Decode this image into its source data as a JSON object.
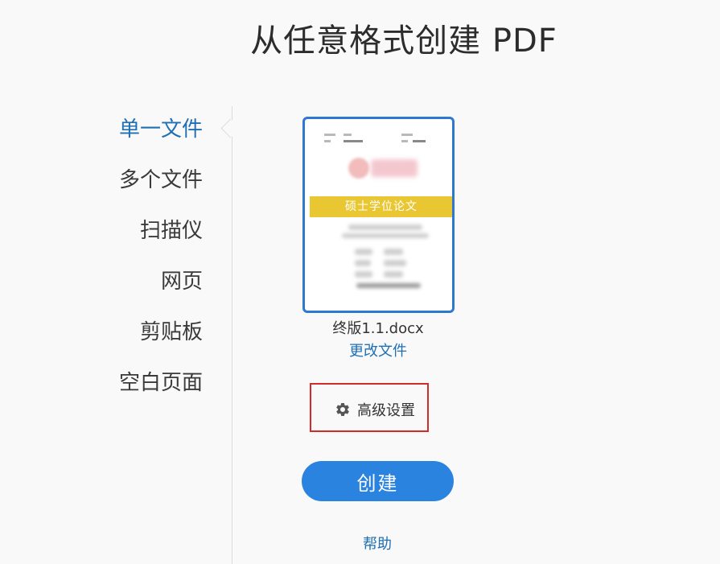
{
  "header": {
    "title": "从任意格式创建 PDF"
  },
  "sidebar": {
    "items": [
      {
        "label": "单一文件",
        "active": true
      },
      {
        "label": "多个文件",
        "active": false
      },
      {
        "label": "扫描仪",
        "active": false
      },
      {
        "label": "网页",
        "active": false
      },
      {
        "label": "剪贴板",
        "active": false
      },
      {
        "label": "空白页面",
        "active": false
      }
    ]
  },
  "main": {
    "thumbnail_banner": "硕士学位论文",
    "file_name": "终版1.1.docx",
    "change_file_label": "更改文件",
    "advanced_settings_label": "高级设置",
    "create_label": "创建",
    "help_label": "帮助"
  },
  "colors": {
    "accent": "#2b83e0",
    "link": "#1f6fb5",
    "highlight_box": "#d42a2a",
    "banner": "#e9c733"
  }
}
